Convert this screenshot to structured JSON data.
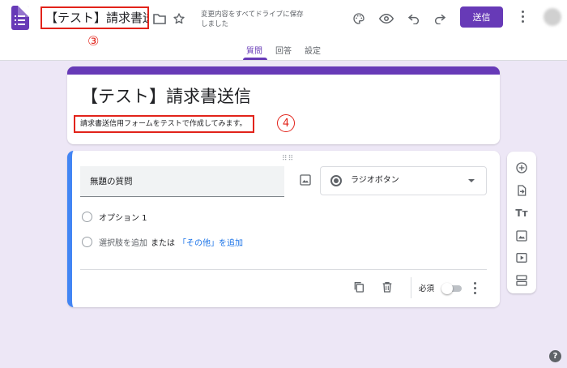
{
  "header": {
    "title": "【テスト】請求書送信",
    "save_status": "変更内容をすべてドライブに保存しました",
    "send_label": "送信",
    "callout_title": "③"
  },
  "tabs": [
    {
      "label": "質問",
      "active": true
    },
    {
      "label": "回答",
      "active": false
    },
    {
      "label": "設定",
      "active": false
    }
  ],
  "form": {
    "title": "【テスト】請求書送信",
    "description": "請求書送信用フォームをテストで作成してみます。",
    "callout_description": "4"
  },
  "question": {
    "title": "無題の質問",
    "type": "ラジオボタン",
    "options": [
      "オプション 1"
    ],
    "add_option": "選択肢を追加",
    "or_text": "または",
    "add_other": "「その他」を追加",
    "required_label": "必須",
    "required": false
  },
  "side_toolbar": [
    "add-circle-icon",
    "import-questions-icon",
    "title-text-icon",
    "image-icon",
    "video-icon",
    "section-icon"
  ],
  "colors": {
    "accent": "#673ab7",
    "callout": "#e2231a",
    "question_border": "#4285f4",
    "background": "#ede7f6"
  }
}
